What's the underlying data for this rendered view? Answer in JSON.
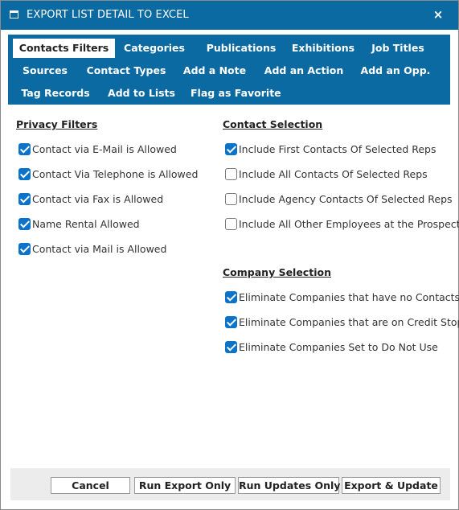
{
  "dialog": {
    "title": "EXPORT LIST DETAIL TO EXCEL",
    "close_glyph": "×"
  },
  "tabs": [
    {
      "label": "Contacts Filters",
      "active": true
    },
    {
      "label": "Categories",
      "active": false
    },
    {
      "label": "Publications",
      "active": false
    },
    {
      "label": "Exhibitions",
      "active": false
    },
    {
      "label": "Job Titles",
      "active": false
    },
    {
      "label": "Sources",
      "active": false
    },
    {
      "label": "Contact Types",
      "active": false
    },
    {
      "label": "Add a Note",
      "active": false
    },
    {
      "label": "Add an Action",
      "active": false
    },
    {
      "label": "Add an Opp.",
      "active": false
    },
    {
      "label": "Tag Records",
      "active": false
    },
    {
      "label": "Add to Lists",
      "active": false
    },
    {
      "label": "Flag as Favorite",
      "active": false
    }
  ],
  "privacy_filters": {
    "title": "Privacy Filters",
    "items": [
      {
        "label": "Contact via E-Mail is Allowed",
        "checked": true
      },
      {
        "label": "Contact Via Telephone is Allowed",
        "checked": true
      },
      {
        "label": "Contact via Fax is Allowed",
        "checked": true
      },
      {
        "label": "Name Rental Allowed",
        "checked": true
      },
      {
        "label": "Contact via Mail is Allowed",
        "checked": true
      }
    ]
  },
  "contact_selection": {
    "title": "Contact Selection",
    "items": [
      {
        "label": "Include First Contacts Of Selected Reps",
        "checked": true
      },
      {
        "label": "Include All Contacts Of Selected Reps",
        "checked": false
      },
      {
        "label": "Include Agency Contacts Of Selected Reps",
        "checked": false
      },
      {
        "label": "Include All Other Employees at the Prospect",
        "checked": false
      }
    ]
  },
  "company_selection": {
    "title": "Company Selection",
    "items": [
      {
        "label": "Eliminate Companies that have no Contacts",
        "checked": true
      },
      {
        "label": "Eliminate Companies that are on Credit Stop",
        "checked": true
      },
      {
        "label": "Eliminate Companies Set to Do Not Use",
        "checked": true
      }
    ]
  },
  "footer": {
    "cancel": "Cancel",
    "run_export_only": "Run Export Only",
    "run_updates_only": "Run Updates Only",
    "export_update": "Export & Update"
  },
  "colors": {
    "accent": "#0b6aa2",
    "checkbox": "#0b73c9",
    "footer_bg": "#ececec"
  },
  "icons": {
    "window": "window-icon",
    "close": "close-icon",
    "check": "checkmark-icon"
  }
}
